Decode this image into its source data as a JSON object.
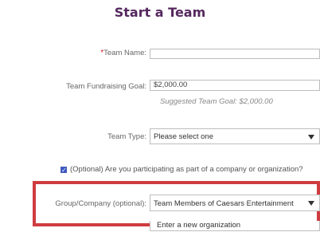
{
  "form": {
    "title": "Start a Team",
    "team_name": {
      "required_marker": "*",
      "label": "Team Name:",
      "value": ""
    },
    "fundraising_goal": {
      "label": "Team Fundraising Goal:",
      "value": "$2,000.00",
      "hint": "Suggested Team Goal: $2,000.00"
    },
    "team_type": {
      "label": "Team Type:",
      "selected": "Please select one",
      "icon": "triangle-down-icon"
    },
    "company_checkbox": {
      "checked": true,
      "label": "(Optional) Are you participating as part of a company or organization?"
    },
    "group_company": {
      "label": "Group/Company (optional):",
      "selected": "Team Members of Caesars Entertainment",
      "icon": "triangle-down-icon",
      "options": [
        "Enter a new organization"
      ]
    }
  },
  "colors": {
    "title": "#55285e",
    "highlight": "#cf3c40",
    "required": "#d0202f",
    "checkbox": "#3a56c5"
  }
}
